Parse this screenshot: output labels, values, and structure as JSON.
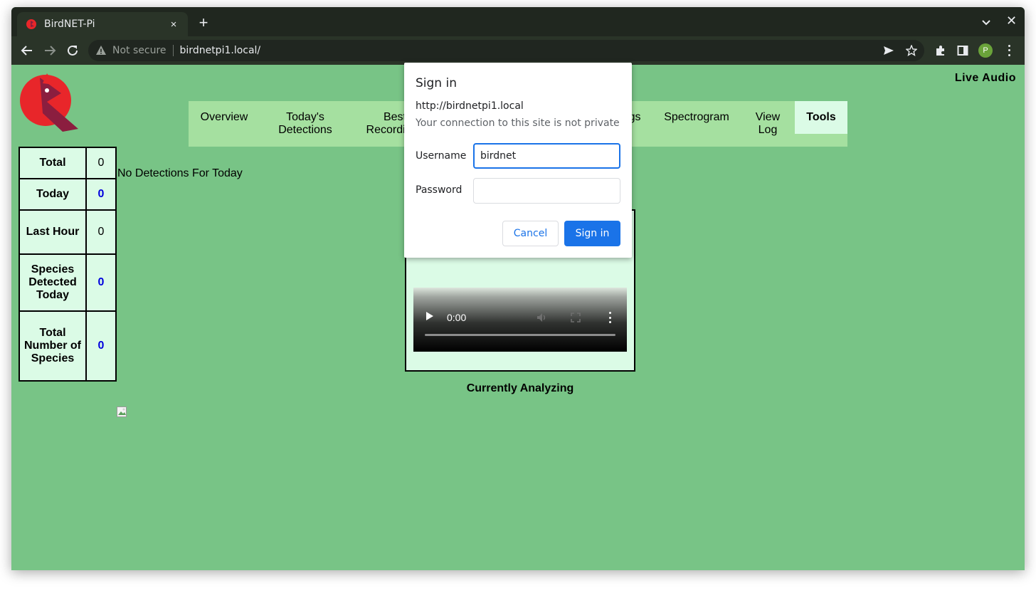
{
  "browser": {
    "tab_title": "BirdNET-Pi",
    "new_tab_label": "+",
    "close_tab_label": "×",
    "window_close_label": "✕",
    "not_secure_label": "Not secure",
    "url": "birdnetpi1.local/",
    "profile_initial": "P",
    "icons": [
      "back-icon",
      "forward-icon",
      "reload-icon",
      "warning-icon",
      "send-icon",
      "star-icon",
      "extensions-icon",
      "sidepanel-icon",
      "menu-icon"
    ]
  },
  "page": {
    "live_audio": "Live Audio",
    "nav": [
      {
        "label": "Overview"
      },
      {
        "label": "Today's Detections"
      },
      {
        "label": "Best Recordings"
      },
      {
        "label": "Recordings"
      },
      {
        "label": "Spectrogram"
      },
      {
        "label": "View Log"
      },
      {
        "label": "Tools"
      }
    ],
    "active_nav": "Tools",
    "stats": [
      {
        "label": "Total",
        "value": "0"
      },
      {
        "label": "Today",
        "value": "0"
      },
      {
        "label": "Last Hour",
        "value": "0"
      },
      {
        "label": "Species Detected Today",
        "value": "0"
      },
      {
        "label": "Total Number of Species",
        "value": "0"
      }
    ],
    "no_detections": "No Detections For Today",
    "player": {
      "time": "0:00"
    },
    "currently_analyzing": "Currently Analyzing"
  },
  "dialog": {
    "title": "Sign in",
    "origin": "http://birdnetpi1.local",
    "warning": "Your connection to this site is not private",
    "username_label": "Username",
    "username_value": "birdnet",
    "password_label": "Password",
    "password_value": "",
    "cancel_label": "Cancel",
    "signin_label": "Sign in"
  },
  "colors": {
    "page_bg": "#78c486",
    "nav_bg": "#a5e0a0",
    "panel_bg": "#dbfbe6",
    "primary_button": "#1a73e8",
    "stat_highlight": "#0000dd"
  }
}
